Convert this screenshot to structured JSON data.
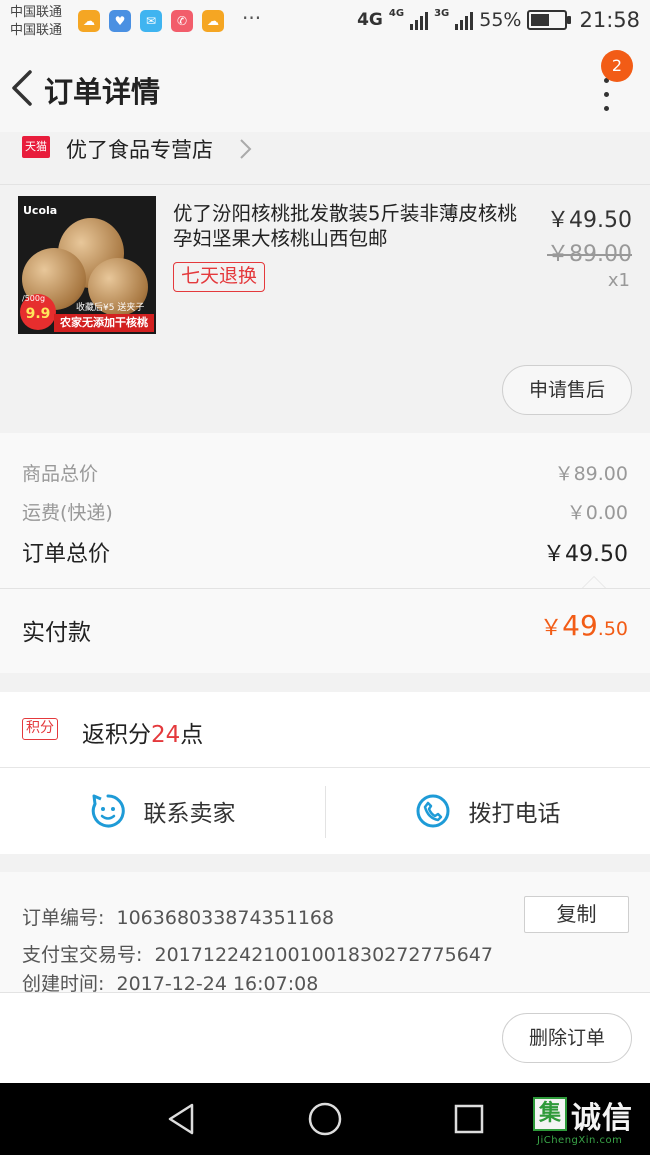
{
  "status_bar": {
    "carrier_1": "中国联通",
    "carrier_2": "中国联通",
    "more": "···",
    "network_1": "4G",
    "network_2": "4G",
    "network_3": "3G",
    "battery": "55%",
    "battery_level": 0.55,
    "time": "21:58"
  },
  "header": {
    "title": "订单详情",
    "badge_count": "2"
  },
  "store": {
    "platform_logo": "天猫",
    "name": "优了食品专营店"
  },
  "product": {
    "title": "优了汾阳核桃批发散装5斤装非薄皮核桃孕妇坚果大核桃山西包邮",
    "return_policy": "七天退换",
    "price": "￥49.50",
    "original_price": "￥89.00",
    "quantity": "x1",
    "after_sale_button": "申请售后",
    "image": {
      "brand": "Ucola",
      "unit": "/500g",
      "price": "9.9",
      "promo": "收藏后¥5 送夹子",
      "banner": "农家无添加干核桃"
    }
  },
  "summary": {
    "goods_total_label": "商品总价",
    "goods_total": "￥89.00",
    "shipping_label": "运费(快递)",
    "shipping": "￥0.00",
    "order_total_label": "订单总价",
    "order_total": "￥49.50",
    "paid_label": "实付款",
    "paid_currency": "￥",
    "paid_integer": "49",
    "paid_decimal": ".50"
  },
  "points": {
    "tag": "积分",
    "prefix": "返积分",
    "value": "24",
    "suffix": "点"
  },
  "contact": {
    "seller_label": "联系卖家",
    "phone_label": "拨打电话"
  },
  "order_info": {
    "order_no_label": "订单编号:",
    "order_no": "106368033874351168",
    "copy_button": "复制",
    "alipay_no_label": "支付宝交易号:",
    "alipay_no": "2017122421001001830272775647",
    "created_label": "创建时间:",
    "created": "2017-12-24 16:07:08"
  },
  "bottom": {
    "delete_button": "删除订单"
  },
  "watermark": {
    "logo": "集",
    "text": "诚信",
    "sub": "JiChengXin.com"
  },
  "colors": {
    "accent_orange": "#f25c16",
    "accent_red": "#e4393c",
    "tmall_red": "#e81d3c",
    "contact_blue": "#1e9bd7"
  }
}
